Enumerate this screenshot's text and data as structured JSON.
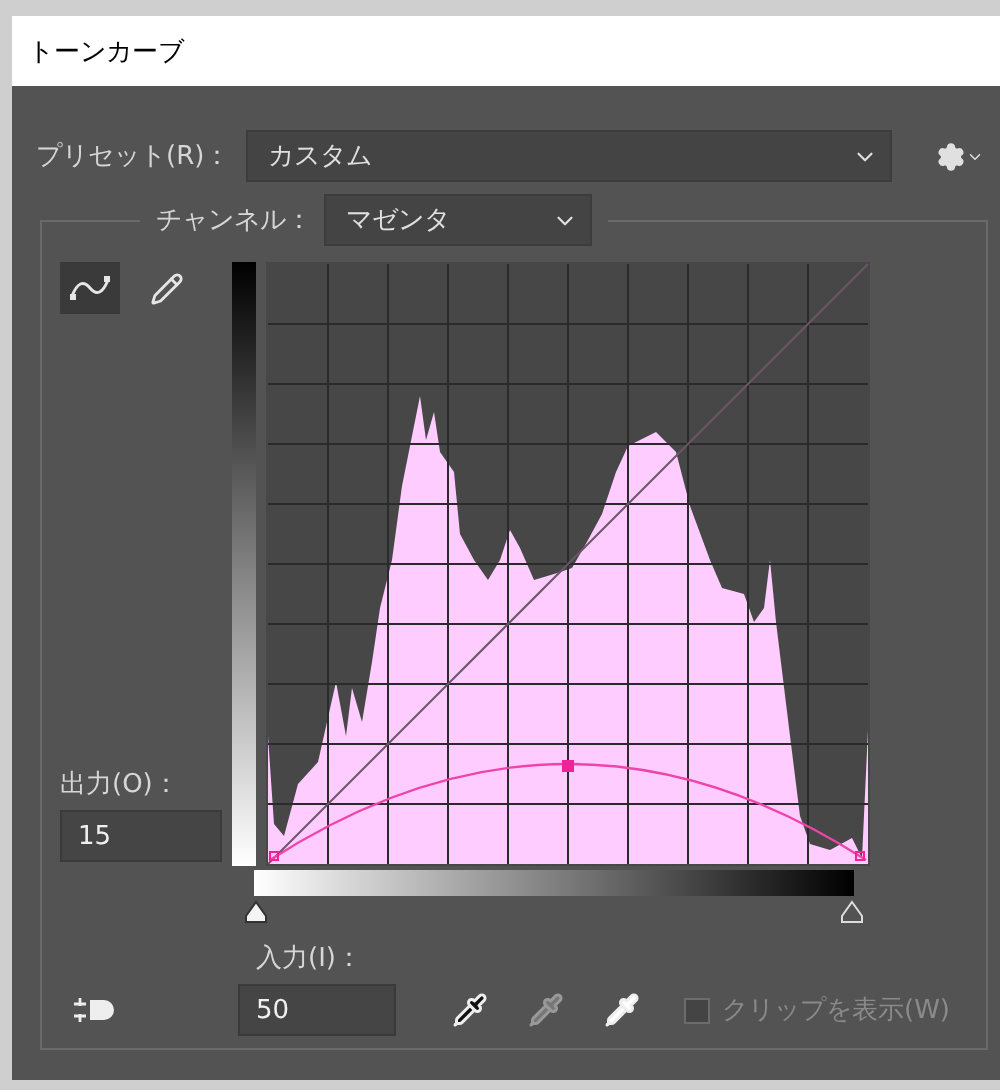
{
  "window": {
    "title": "トーンカーブ"
  },
  "preset": {
    "label": "プリセット(R)：",
    "value": "カスタム"
  },
  "channel": {
    "label": "チャンネル：",
    "value": "マゼンタ"
  },
  "tools": [
    {
      "kind": "curve",
      "selected": true
    },
    {
      "kind": "pencil",
      "selected": false
    }
  ],
  "output": {
    "label": "出力(O)：",
    "value": "15"
  },
  "input": {
    "label": "入力(I)：",
    "value": "50"
  },
  "clip": {
    "label": "クリップを表示(W)",
    "checked": false,
    "disabled": true
  }
}
